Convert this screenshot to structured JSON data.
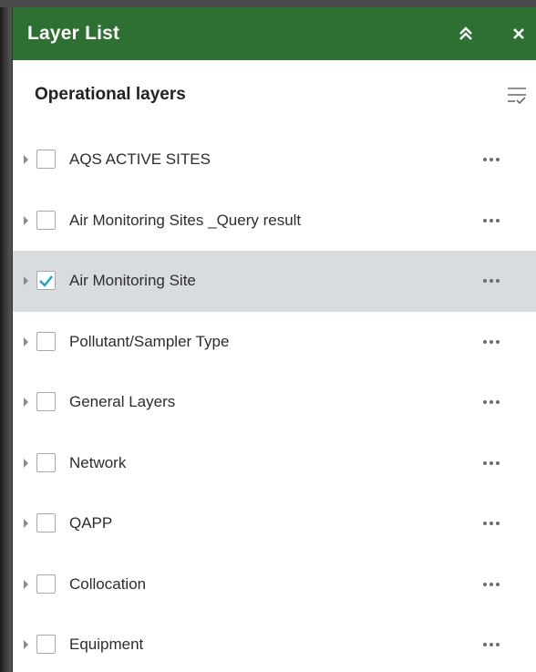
{
  "header": {
    "title": "Layer List",
    "collapse_icon": "double-chevron-up-icon",
    "close_icon": "close-icon",
    "color": "#2e7031"
  },
  "section": {
    "title": "Operational layers",
    "filter_icon": "filter-list-icon"
  },
  "layers": [
    {
      "label": "AQS ACTIVE SITES",
      "checked": false,
      "selected": false
    },
    {
      "label": "Air Monitoring Sites _Query result",
      "checked": false,
      "selected": false
    },
    {
      "label": "Air Monitoring Site",
      "checked": true,
      "selected": true
    },
    {
      "label": "Pollutant/Sampler Type",
      "checked": false,
      "selected": false
    },
    {
      "label": "General Layers",
      "checked": false,
      "selected": false
    },
    {
      "label": "Network",
      "checked": false,
      "selected": false
    },
    {
      "label": "QAPP",
      "checked": false,
      "selected": false
    },
    {
      "label": "Collocation",
      "checked": false,
      "selected": false
    },
    {
      "label": "Equipment",
      "checked": false,
      "selected": false
    }
  ],
  "colors": {
    "check": "#1aa3c9",
    "selected_row": "#d9dcde"
  }
}
